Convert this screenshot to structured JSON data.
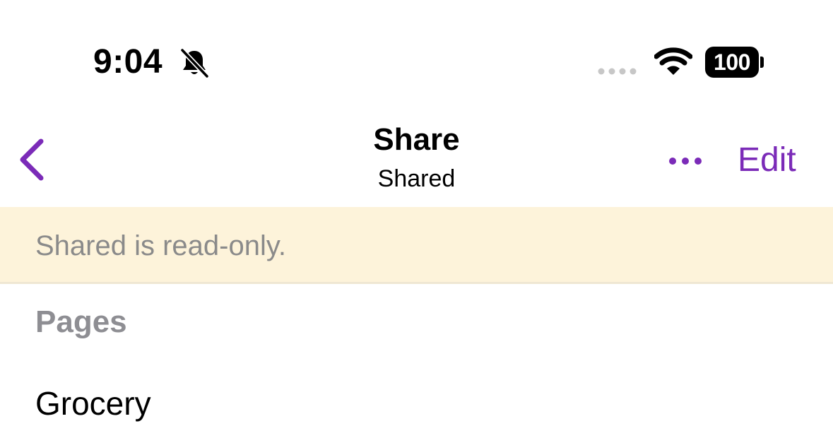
{
  "status_bar": {
    "time": "9:04",
    "silent_icon": "bell-slash-icon",
    "signal_icon": "cellular-signal-icon",
    "wifi_icon": "wifi-icon",
    "battery": "100"
  },
  "nav": {
    "back_icon": "chevron-left-icon",
    "title": "Share",
    "subtitle": "Shared",
    "more_icon": "ellipsis-icon",
    "edit_label": "Edit",
    "accent_color": "#7b2bb8"
  },
  "banner": {
    "text": "Shared is read-only.",
    "background": "#fdf3da"
  },
  "pages": {
    "header": "Pages",
    "items": [
      {
        "label": "Grocery"
      }
    ]
  }
}
